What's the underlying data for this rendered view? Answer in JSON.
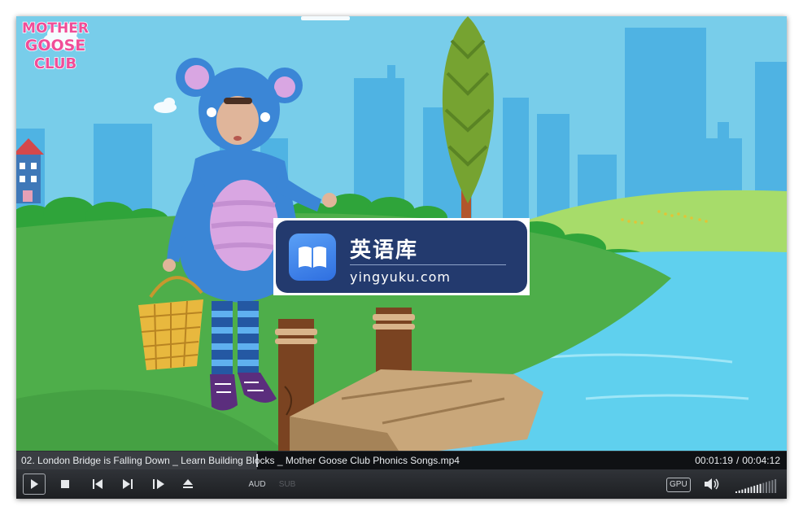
{
  "video": {
    "watermark": {
      "title": "英语库",
      "url": "yingyuku.com"
    },
    "brand_logo": {
      "line1": "MOTHER",
      "line2": "GOOSE",
      "line3": "CLUB"
    }
  },
  "info_bar": {
    "file_name": "02. London Bridge is Falling Down _ Learn Building Blocks _ Mother Goose Club Phonics Songs.mp4",
    "current_time": "00:01:19",
    "separator": "/",
    "total_time": "00:04:12",
    "progress_fraction": 0.313
  },
  "controls": {
    "audio_label": "AUD",
    "subtitle_label": "SUB",
    "gpu_label": "GPU",
    "volume_level": 0.6,
    "icons": [
      "play-icon",
      "stop-icon",
      "previous-icon",
      "next-icon",
      "frame-step-icon",
      "eject-icon",
      "speaker-icon"
    ]
  },
  "colors": {
    "sky": "#78cdea",
    "grass": "#4eae4a",
    "water": "#5fd0ee",
    "watermark_bg": "#233a6e",
    "controls_bg": "#25282c"
  }
}
